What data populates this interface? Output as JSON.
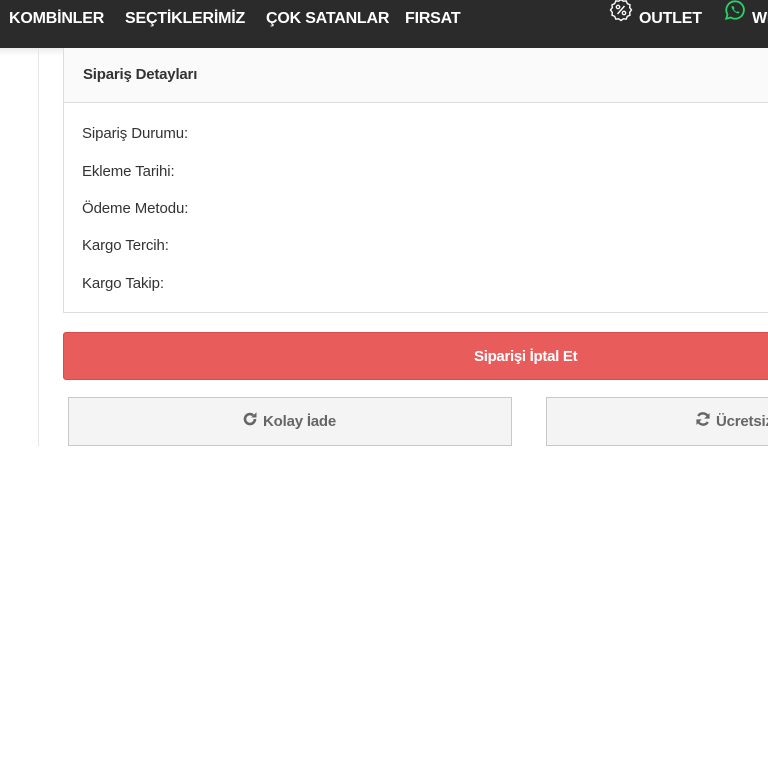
{
  "nav": {
    "items": [
      {
        "label": "KOMBİNLER"
      },
      {
        "label": "SEÇTİKLERİMİZ"
      },
      {
        "label": "ÇOK SATANLAR"
      },
      {
        "label": "FIRSAT"
      }
    ],
    "outlet_label": "OUTLET",
    "outlet_icon": "percent-icon",
    "whatsapp_label": "WH",
    "whatsapp_icon": "whatsapp-icon",
    "whatsapp_color": "#25d366"
  },
  "order_details": {
    "title": "Sipariş Detayları",
    "labels": [
      "Sipariş Durumu:",
      "Ekleme Tarihi:",
      "Ödeme Metodu:",
      "Kargo Tercih:",
      "Kargo Takip:"
    ]
  },
  "actions": {
    "cancel_label": "Siparişi İptal Et",
    "cancel_color": "#e85c5c",
    "easy_return_label": "Kolay İade",
    "easy_return_icon": "rotate-right-icon",
    "free_label": "Ücretsiz",
    "free_icon": "refresh-icon"
  }
}
